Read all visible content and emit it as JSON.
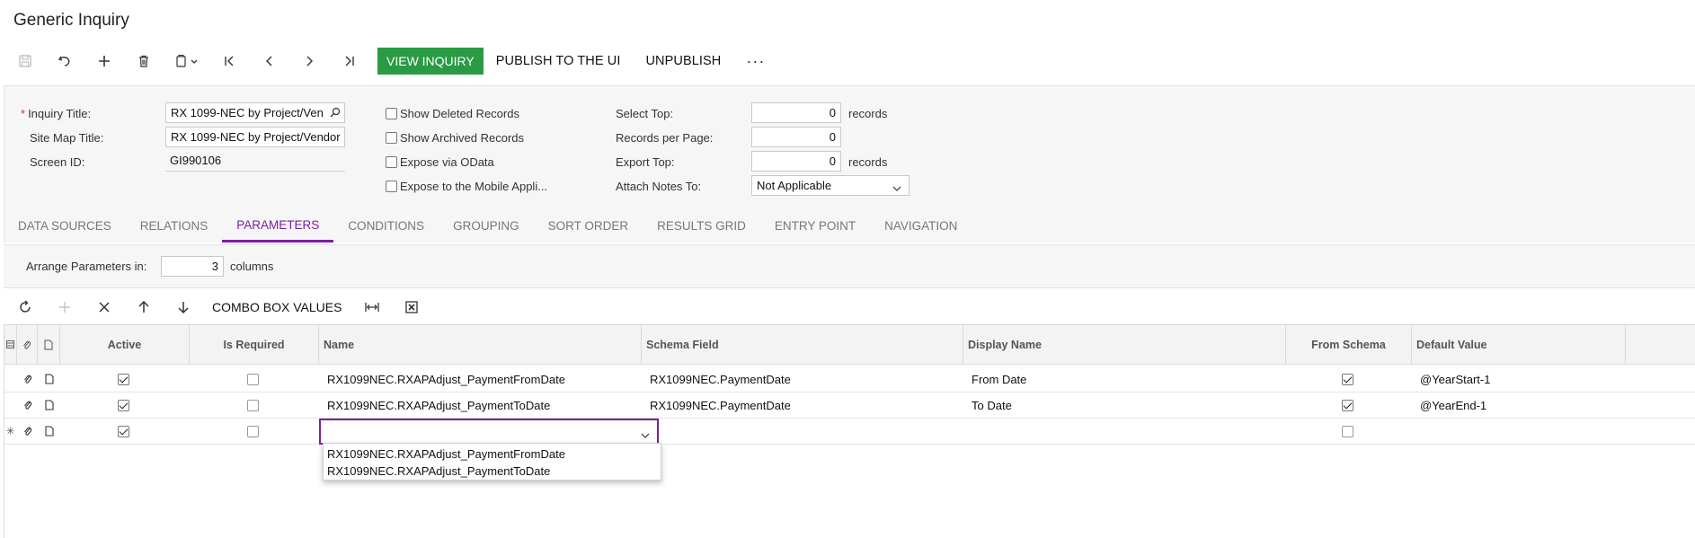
{
  "page": {
    "title": "Generic Inquiry"
  },
  "toolbar": {
    "view_inquiry": "VIEW INQUIRY",
    "publish": "PUBLISH TO THE UI",
    "unpublish": "UNPUBLISH",
    "more": "···"
  },
  "form": {
    "inquiry_title_label": "Inquiry Title:",
    "inquiry_title_value": "RX 1099-NEC by Project/Ven",
    "site_map_title_label": "Site Map Title:",
    "site_map_title_value": "RX 1099-NEC by Project/Vendor",
    "screen_id_label": "Screen ID:",
    "screen_id_value": "GI990106",
    "show_deleted": "Show Deleted Records",
    "show_archived": "Show Archived Records",
    "expose_odata": "Expose via OData",
    "expose_mobile": "Expose to the Mobile Appli...",
    "select_top_label": "Select Top:",
    "select_top_value": "0",
    "select_top_after": "records",
    "records_per_page_label": "Records per Page:",
    "records_per_page_value": "0",
    "export_top_label": "Export Top:",
    "export_top_value": "0",
    "export_top_after": "records",
    "attach_notes_label": "Attach Notes To:",
    "attach_notes_value": "Not Applicable"
  },
  "tabs": [
    "DATA SOURCES",
    "RELATIONS",
    "PARAMETERS",
    "CONDITIONS",
    "GROUPING",
    "SORT ORDER",
    "RESULTS GRID",
    "ENTRY POINT",
    "NAVIGATION"
  ],
  "params": {
    "arrange_label": "Arrange Parameters in:",
    "arrange_value": "3",
    "arrange_after": "columns"
  },
  "grid_toolbar": {
    "combo_box_values": "COMBO BOX VALUES"
  },
  "grid": {
    "headers": {
      "active": "Active",
      "is_required": "Is Required",
      "name": "Name",
      "schema_field": "Schema Field",
      "display_name": "Display Name",
      "from_schema": "From Schema",
      "default_value": "Default Value"
    },
    "rows": [
      {
        "active": true,
        "is_required": false,
        "name": "RX1099NEC.RXAPAdjust_PaymentFromDate",
        "schema_field": "RX1099NEC.PaymentDate",
        "display_name": "From Date",
        "from_schema": true,
        "default_value": "@YearStart-1"
      },
      {
        "active": true,
        "is_required": false,
        "name": "RX1099NEC.RXAPAdjust_PaymentToDate",
        "schema_field": "RX1099NEC.PaymentDate",
        "display_name": "To Date",
        "from_schema": true,
        "default_value": "@YearEnd-1"
      }
    ],
    "new_row": {
      "active": true,
      "is_required": false,
      "from_schema": false,
      "name": ""
    }
  },
  "dropdown": {
    "options": [
      "RX1099NEC.RXAPAdjust_PaymentFromDate",
      "RX1099NEC.RXAPAdjust_PaymentToDate"
    ]
  },
  "colors": {
    "accent": "#7a1fa2",
    "primary_button": "#2a9a44"
  }
}
